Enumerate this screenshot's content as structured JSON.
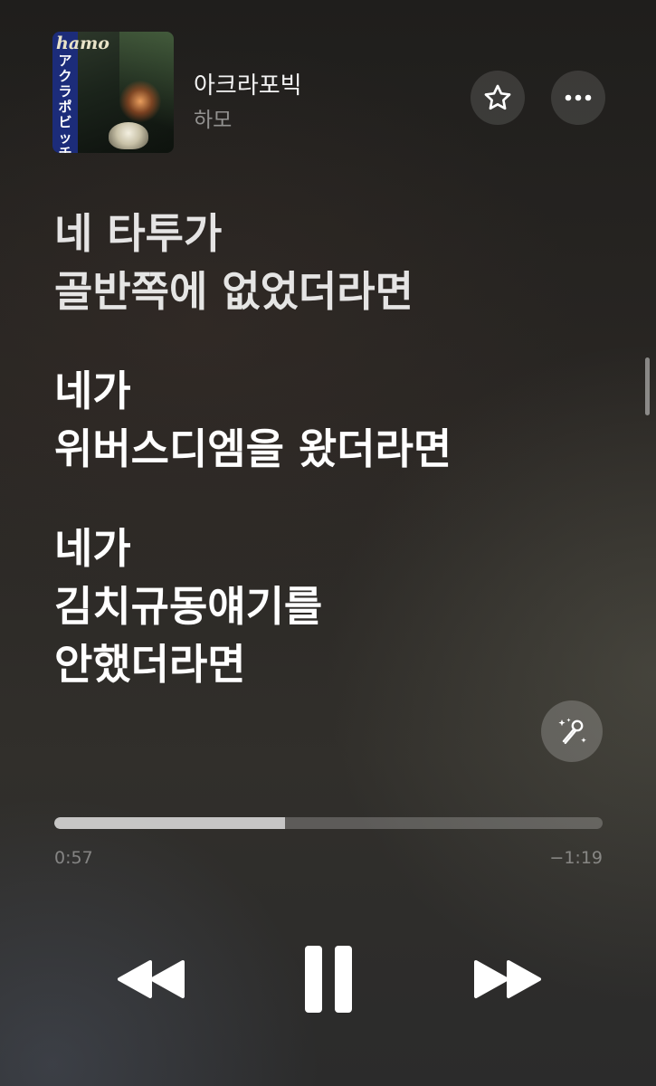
{
  "now_playing": {
    "title": "아크라포빅",
    "artist": "하모",
    "album_art": {
      "logo_text": "hamo",
      "spine_text": "アクラポビッチ"
    }
  },
  "header_actions": {
    "favorite_icon": "star-icon",
    "more_icon": "ellipsis-icon"
  },
  "lyrics": {
    "verses": [
      {
        "lines": [
          "네 타투가",
          "골반쪽에 없었더라면"
        ]
      },
      {
        "lines": [
          "네가",
          "위버스디엠을 왔더라면"
        ]
      },
      {
        "lines": [
          "네가",
          "김치규동얘기를",
          "안했더라면"
        ]
      }
    ],
    "sing_icon": "microphone-sparkle-icon"
  },
  "playback": {
    "elapsed": "0:57",
    "remaining": "−1:19",
    "progress_fraction": 0.42
  },
  "transport": {
    "rewind_icon": "rewind-icon",
    "pause_icon": "pause-icon",
    "forward_icon": "fast-forward-icon"
  },
  "colors": {
    "accent": "#ffffff",
    "background": "#2a2724"
  }
}
